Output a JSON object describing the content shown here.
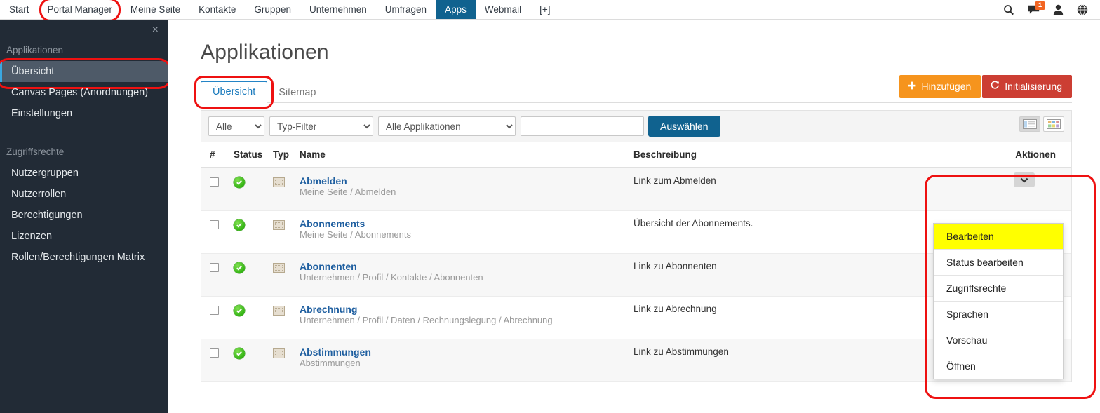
{
  "topnav": {
    "items": [
      {
        "label": "Start",
        "state": "normal"
      },
      {
        "label": "Portal Manager",
        "state": "ringed"
      },
      {
        "label": "Meine Seite",
        "state": "normal"
      },
      {
        "label": "Kontakte",
        "state": "normal"
      },
      {
        "label": "Gruppen",
        "state": "normal"
      },
      {
        "label": "Unternehmen",
        "state": "normal"
      },
      {
        "label": "Umfragen",
        "state": "normal"
      },
      {
        "label": "Apps",
        "state": "active"
      },
      {
        "label": "Webmail",
        "state": "normal"
      },
      {
        "label": "[+]",
        "state": "normal"
      }
    ],
    "icons": [
      {
        "name": "search-icon",
        "glyph": "⌕"
      },
      {
        "name": "chat-icon",
        "glyph": "",
        "badge": "1"
      },
      {
        "name": "user-icon",
        "glyph": ""
      },
      {
        "name": "globe-icon",
        "glyph": ""
      }
    ],
    "active_color": "#10628f",
    "badge_color": "#f26522"
  },
  "sidebar": {
    "close_label": "×",
    "groups": [
      {
        "title": "Applikationen",
        "items": [
          {
            "label": "Übersicht",
            "selected": true,
            "ringed": true
          },
          {
            "label": "Canvas Pages (Anordnungen)",
            "selected": false,
            "ringed": false
          },
          {
            "label": "Einstellungen",
            "selected": false,
            "ringed": false
          }
        ]
      },
      {
        "title": "Zugriffsrechte",
        "items": [
          {
            "label": "Nutzergruppen",
            "selected": false,
            "ringed": false
          },
          {
            "label": "Nutzerrollen",
            "selected": false,
            "ringed": false
          },
          {
            "label": "Berechtigungen",
            "selected": false,
            "ringed": false
          },
          {
            "label": "Lizenzen",
            "selected": false,
            "ringed": false
          },
          {
            "label": "Rollen/Berechtigungen Matrix",
            "selected": false,
            "ringed": false
          }
        ]
      }
    ],
    "bg_color": "#222b36",
    "selected_color": "#4e5a68"
  },
  "main": {
    "page_title": "Applikationen",
    "tabs": [
      {
        "label": "Übersicht",
        "active": true,
        "ringed": true
      },
      {
        "label": "Sitemap",
        "active": false,
        "ringed": false
      }
    ],
    "buttons": {
      "add_label": "Hinzufügen",
      "add_icon": "plus-icon",
      "add_color": "#f6941d",
      "init_label": "Initialisierung",
      "init_icon": "refresh-icon",
      "init_color": "#cc3e33"
    },
    "filterbar": {
      "select_all": "Alle",
      "select_type": "Typ-Filter",
      "select_apps": "Alle Applikationen",
      "search_value": "",
      "search_placeholder": "",
      "submit_label": "Auswählen",
      "view_list": "list-view",
      "view_grid": "grid-view"
    },
    "table": {
      "headers": {
        "num": "#",
        "status": "Status",
        "typ": "Typ",
        "name": "Name",
        "desc": "Beschreibung",
        "actions": "Aktionen"
      },
      "rows": [
        {
          "name": "Abmelden",
          "path": "Meine Seite / Abmelden",
          "desc": "Link zum Abmelden",
          "status": "active",
          "typ": "page-icon"
        },
        {
          "name": "Abonnements",
          "path": "Meine Seite / Abonnements",
          "desc": "Übersicht der Abonnements.",
          "status": "active",
          "typ": "page-icon"
        },
        {
          "name": "Abonnenten",
          "path": "Unternehmen / Profil / Kontakte / Abonnenten",
          "desc": "Link zu Abonnenten",
          "status": "active",
          "typ": "page-icon"
        },
        {
          "name": "Abrechnung",
          "path": "Unternehmen / Profil / Daten / Rechnungslegung / Abrechnung",
          "desc": "Link zu Abrechnung",
          "status": "active",
          "typ": "page-icon"
        },
        {
          "name": "Abstimmungen",
          "path": "Abstimmungen",
          "desc": "Link zu Abstimmungen",
          "status": "active",
          "typ": "page-icon"
        }
      ]
    },
    "dropdown": {
      "items": [
        {
          "label": "Bearbeiten",
          "highlighted": true
        },
        {
          "label": "Status bearbeiten",
          "highlighted": false
        },
        {
          "label": "Zugriffsrechte",
          "highlighted": false
        },
        {
          "label": "Sprachen",
          "highlighted": false
        },
        {
          "label": "Vorschau",
          "highlighted": false
        },
        {
          "label": "Öffnen",
          "highlighted": false
        }
      ],
      "highlight_color": "#ffff00"
    },
    "annotation_color": "#ee1111"
  }
}
